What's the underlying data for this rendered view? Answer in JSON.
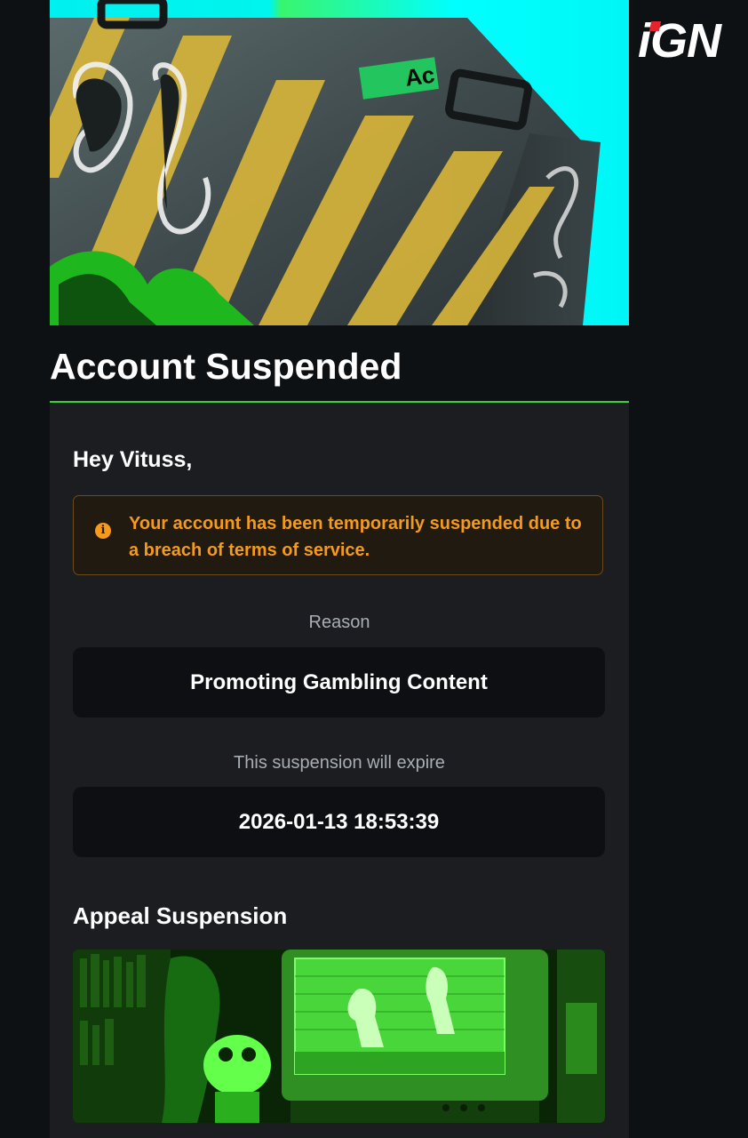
{
  "brand": {
    "logo_text": "iGN",
    "accent_color": "#3ccf3c",
    "logo_dot_color": "#e3242b"
  },
  "hero": {
    "image_name": "graffiti-briefcase-illustration",
    "sticker_text": "Ac"
  },
  "page": {
    "title": "Account Suspended"
  },
  "card": {
    "greeting": "Hey Vituss,",
    "alert": {
      "icon": "info-icon",
      "text": "Your account has been temporarily suspended due to a breach of terms of service.",
      "color": "#f59a1b"
    },
    "reason_label": "Reason",
    "reason_value": "Promoting Gambling Content",
    "expiry_label": "This suspension will expire",
    "expiry_value": "2026-01-13 18:53:39",
    "appeal_heading": "Appeal Suspension",
    "appeal_image": "retro-gaming-setup-image"
  }
}
